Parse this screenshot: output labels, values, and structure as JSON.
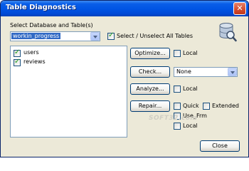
{
  "window": {
    "title": "Table Diagnostics",
    "close_glyph": "✕"
  },
  "db_section": {
    "label": "Select Database and Table(s)",
    "selected_database": "workin_progress",
    "select_all_label": "Select / Unselect All Tables",
    "select_all_checked": true
  },
  "tables": [
    {
      "name": "users",
      "checked": true
    },
    {
      "name": "reviews",
      "checked": true
    }
  ],
  "actions": {
    "optimize": {
      "label": "Optimize...",
      "local_label": "Local",
      "local_checked": false
    },
    "check": {
      "label": "Check...",
      "option": "None"
    },
    "analyze": {
      "label": "Analyze...",
      "local_label": "Local",
      "local_checked": false
    },
    "repair": {
      "label": "Repair...",
      "quick_label": "Quick",
      "extended_label": "Extended",
      "use_frm_label": "Use_Frm",
      "local_label": "Local"
    }
  },
  "footer": {
    "close_label": "Close"
  },
  "watermark": "SOFT32.com",
  "icons": {
    "database": "database-search-icon",
    "close": "close-icon",
    "dropdown": "chevron-down-icon"
  }
}
